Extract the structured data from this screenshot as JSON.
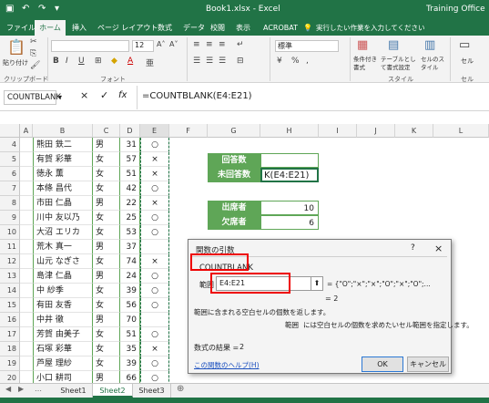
{
  "titlebar": {
    "title": "Book1.xlsx - Excel",
    "right": "Training Office"
  },
  "tabs": [
    "ファイル",
    "ホーム",
    "挿入",
    "ページ レイアウト",
    "数式",
    "データ",
    "校閲",
    "表示",
    "ACROBAT"
  ],
  "tell_me": "実行したい作業を入力してください",
  "ribbon": {
    "paste": "貼り付け",
    "font_size": "12",
    "bold": "B",
    "italic": "I",
    "underline": "U",
    "font_color": "A",
    "number_format": "標準",
    "currency": "%",
    "conditional": "条件付き書式",
    "table_format": "テーブルとして書式設定",
    "cell_styles": "セルのスタイル",
    "cell_group": "セル",
    "groups": {
      "clipboard": "クリップボード",
      "font": "フォント",
      "style": "スタイル",
      "cell": "セル"
    }
  },
  "formula": {
    "name_box": "COUNTBLANK",
    "cancel": "×",
    "enter": "✓",
    "fx": "fx",
    "formula": "=COUNTBLANK(E4:E21)"
  },
  "columns": [
    "A",
    "B",
    "C",
    "D",
    "E",
    "F",
    "G",
    "H",
    "I",
    "J",
    "K",
    "L"
  ],
  "rows": [
    {
      "n": "4",
      "name": "熊田 鉄二",
      "gender": "男",
      "age": "31",
      "att": "○"
    },
    {
      "n": "5",
      "name": "有賀 彩華",
      "gender": "女",
      "age": "57",
      "att": "×"
    },
    {
      "n": "6",
      "name": "徳永 薫",
      "gender": "女",
      "age": "51",
      "att": "×"
    },
    {
      "n": "7",
      "name": "本條 昌代",
      "gender": "女",
      "age": "42",
      "att": "○"
    },
    {
      "n": "8",
      "name": "市田 仁晶",
      "gender": "男",
      "age": "22",
      "att": "×"
    },
    {
      "n": "9",
      "name": "川中 友以乃",
      "gender": "女",
      "age": "25",
      "att": "○"
    },
    {
      "n": "10",
      "name": "大沼 エリカ",
      "gender": "女",
      "age": "53",
      "att": "○"
    },
    {
      "n": "11",
      "name": "荒木 真一",
      "gender": "男",
      "age": "37",
      "att": ""
    },
    {
      "n": "12",
      "name": "山元 なぎさ",
      "gender": "女",
      "age": "74",
      "att": "×"
    },
    {
      "n": "13",
      "name": "島津 仁晶",
      "gender": "男",
      "age": "24",
      "att": "○"
    },
    {
      "n": "14",
      "name": "中 紗季",
      "gender": "女",
      "age": "39",
      "att": "○"
    },
    {
      "n": "15",
      "name": "有田 友香",
      "gender": "女",
      "age": "56",
      "att": "○"
    },
    {
      "n": "16",
      "name": "中井 徹",
      "gender": "男",
      "age": "70",
      "att": ""
    },
    {
      "n": "17",
      "name": "芳賀 由美子",
      "gender": "女",
      "age": "51",
      "att": "○"
    },
    {
      "n": "18",
      "name": "石塚 彩華",
      "gender": "女",
      "age": "35",
      "att": "×"
    },
    {
      "n": "19",
      "name": "芦屋 理紗",
      "gender": "女",
      "age": "39",
      "att": "○"
    },
    {
      "n": "20",
      "name": "小口 耕司",
      "gender": "男",
      "age": "66",
      "att": "○"
    },
    {
      "n": "21",
      "name": "",
      "gender": "",
      "age": "",
      "att": ""
    }
  ],
  "summary": {
    "answered": "回答数",
    "unanswered": "未回答数",
    "unanswered_formula": "K(E4:E21)",
    "present": "出席者",
    "present_val": "10",
    "absent": "欠席者",
    "absent_val": "6"
  },
  "dialog": {
    "title": "関数の引数",
    "help": "?",
    "close": "×",
    "func": "COUNTBLANK",
    "range_label": "範囲",
    "range_value": "E4:E21",
    "range_result": "= {\"O\";\"×\";\"×\";\"O\";\"×\";\"O\";...",
    "eq_result": "= 2",
    "description": "範囲に含まれる空白セルの個数を返します。",
    "arg_desc_label": "範囲",
    "arg_desc": "には空白セルの個数を求めたいセル範囲を指定します。",
    "result_label": "数式の結果 =",
    "result": "2",
    "help_link": "この関数のヘルプ(H)",
    "ok": "OK",
    "cancel": "キャンセル"
  },
  "sheets": [
    "Sheet1",
    "Sheet2",
    "Sheet3"
  ],
  "add_sheet": "⊕",
  "status": ""
}
